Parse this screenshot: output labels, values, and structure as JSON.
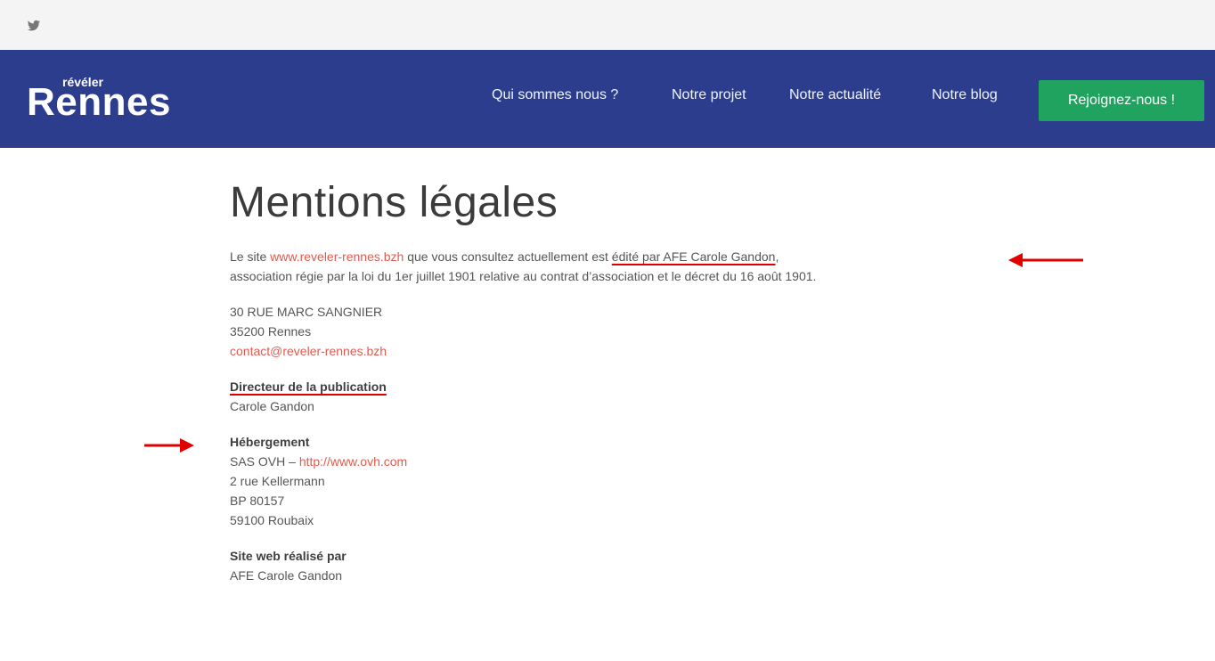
{
  "topbar": {
    "twitter_icon": "twitter-icon",
    "twitter_glyph": "🐦"
  },
  "header": {
    "logo": {
      "small": "révéler",
      "big": "Rennes"
    },
    "nav": [
      "Qui sommes nous ?",
      "Notre projet",
      "Notre actualité",
      "Notre blog"
    ],
    "join_button": "Rejoignez-nous !",
    "colors": {
      "header_bg": "#2d3d8e",
      "join_bg": "#1fa35f"
    }
  },
  "page": {
    "title": "Mentions légales",
    "intro": {
      "p1_a": "Le site ",
      "site_link": "www.reveler-rennes.bzh",
      "p1_b": " que vous consultez actuellement est ",
      "highlight": "édité par AFE Carole Gandon",
      "p1_c": ",",
      "p1_d": "association régie par la loi du 1er juillet 1901 relative au contrat d’association et le décret du 16 août 1901."
    },
    "address": {
      "line1": "30 RUE MARC SANGNIER",
      "line2": "35200   Rennes",
      "email": "contact@reveler-rennes.bzh"
    },
    "director": {
      "heading": "Directeur de la publication",
      "name": "Carole Gandon"
    },
    "hosting": {
      "heading": "Hébergement",
      "line1_a": "SAS OVH – ",
      "line1_link": "http://www.ovh.com",
      "line2": "2 rue Kellermann",
      "line3": "BP 80157",
      "line4": "59100 Roubaix"
    },
    "made_by": {
      "heading": "Site web réalisé par",
      "name": "AFE Carole Gandon"
    }
  },
  "annotations": {
    "arrow_color": "#e00000"
  }
}
